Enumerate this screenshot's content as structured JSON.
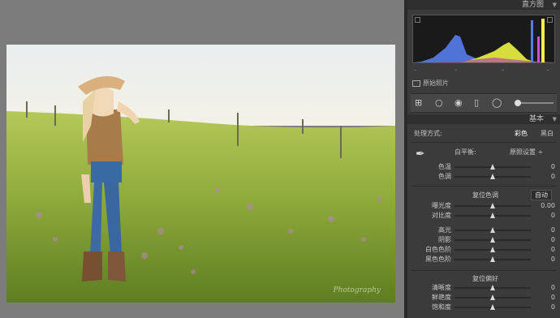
{
  "panel": {
    "histogram_title": "直方图",
    "basic_title": "基本",
    "original_photo_label": "原始照片",
    "histogram_info": [
      "–",
      "–",
      "–",
      "–"
    ]
  },
  "treatment": {
    "label": "处理方式:",
    "color": "彩色",
    "bw": "黑白"
  },
  "wb": {
    "label": "白平衡:",
    "value": "原照设置 ÷"
  },
  "wb_sliders": [
    {
      "label": "色温",
      "value": "0",
      "pos": 0.5
    },
    {
      "label": "色调",
      "value": "0",
      "pos": 0.5
    }
  ],
  "tone": {
    "title": "复位色调",
    "auto": "自动",
    "sliders": [
      {
        "label": "曝光度",
        "value": "0.00",
        "pos": 0.5
      },
      {
        "label": "对比度",
        "value": "0",
        "pos": 0.5
      },
      {
        "label": "高光",
        "value": "0",
        "pos": 0.5
      },
      {
        "label": "阴影",
        "value": "0",
        "pos": 0.5
      },
      {
        "label": "白色色阶",
        "value": "0",
        "pos": 0.5
      },
      {
        "label": "黑色色阶",
        "value": "0",
        "pos": 0.5
      }
    ]
  },
  "presence": {
    "title": "复位偏好",
    "sliders": [
      {
        "label": "清晰度",
        "value": "0",
        "pos": 0.5
      },
      {
        "label": "鲜艳度",
        "value": "0",
        "pos": 0.5
      },
      {
        "label": "饱和度",
        "value": "0",
        "pos": 0.5
      }
    ]
  },
  "photo": {
    "watermark": "Photography"
  },
  "icons": {
    "collapse": "triangle-down-icon",
    "dropper": "eyedropper-icon",
    "crop": "crop-overlay-icon",
    "spot": "spot-removal-icon",
    "redeye": "red-eye-icon",
    "grad": "graduated-filter-icon",
    "radial": "radial-filter-icon",
    "brush": "adjustment-brush-icon"
  }
}
